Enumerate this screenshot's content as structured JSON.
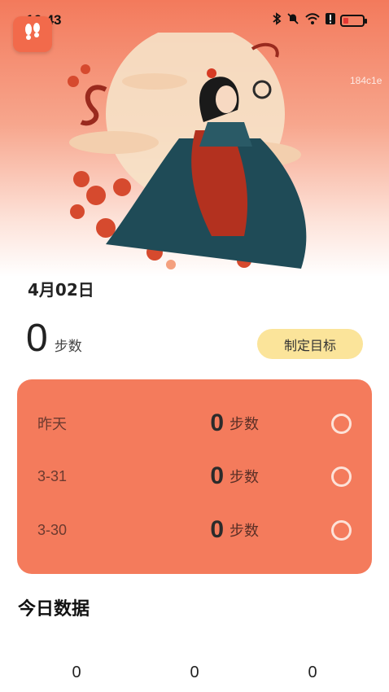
{
  "status_bar": {
    "time": "16:43",
    "icons": [
      "bluetooth-icon",
      "mute-icon",
      "wifi-icon",
      "alert-icon",
      "battery-icon"
    ]
  },
  "app": {
    "icon": "footprints-icon",
    "accent_color": "#f47b5c"
  },
  "watermark": "184c1e",
  "summary": {
    "date": "4月02日",
    "steps": "0",
    "steps_unit": "步数",
    "goal_button_label": "制定目标"
  },
  "history": {
    "rows": [
      {
        "date": "昨天",
        "value": "0",
        "unit": "步数"
      },
      {
        "date": "3-31",
        "value": "0",
        "unit": "步数"
      },
      {
        "date": "3-30",
        "value": "0",
        "unit": "步数"
      }
    ]
  },
  "today": {
    "title": "今日数据",
    "stats": [
      "0",
      "0",
      "0"
    ]
  }
}
